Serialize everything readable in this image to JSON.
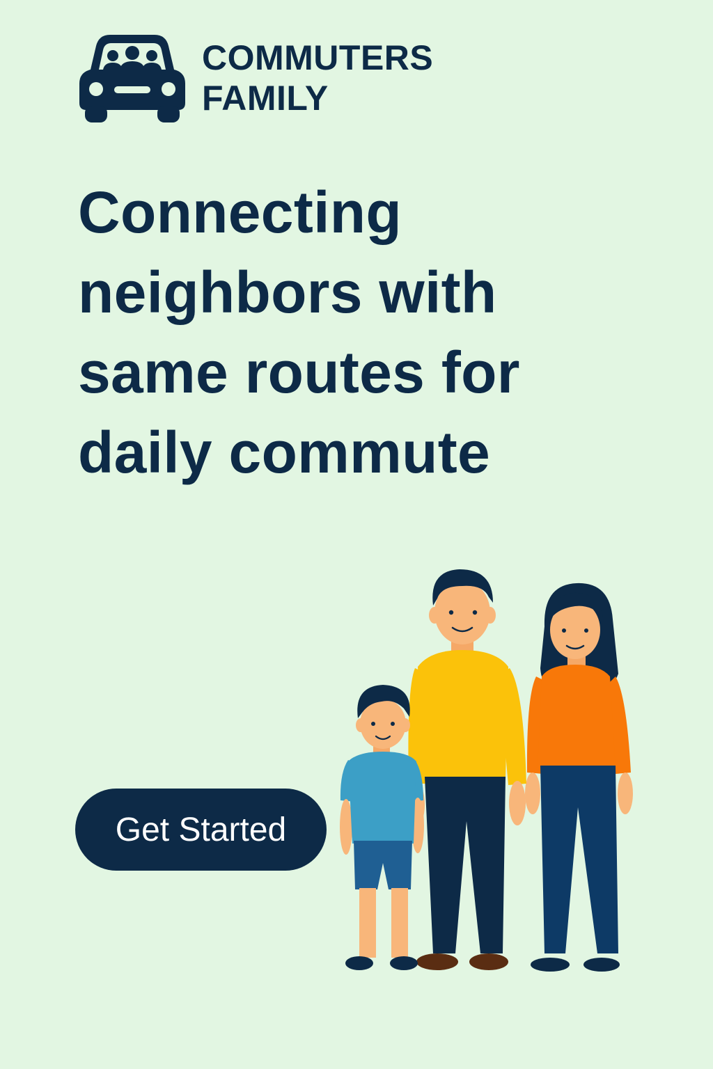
{
  "brand": {
    "line1": "COMMUTERS",
    "line2": "FAMILY",
    "logo_icon": "car-with-people-icon"
  },
  "headline": "Connecting neighbors with same routes for daily commute",
  "cta": {
    "label": "Get Started"
  },
  "illustration": {
    "name": "family-illustration",
    "people": [
      "boy",
      "man",
      "woman"
    ]
  },
  "colors": {
    "background": "#e2f6e2",
    "primary": "#0d2a47",
    "button_text": "#ffffff",
    "yellow_shirt": "#fbc20a",
    "orange_shirt": "#f87809",
    "blue_shirt": "#3c9fc6"
  }
}
